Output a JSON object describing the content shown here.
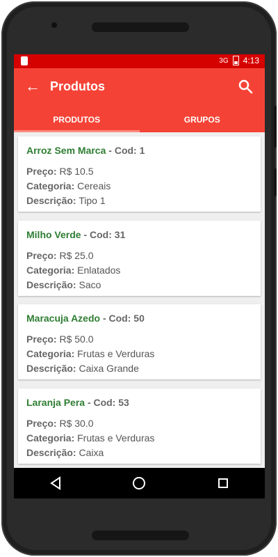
{
  "status_bar": {
    "signal": "3G",
    "time": "4:13"
  },
  "app_bar": {
    "title": "Produtos"
  },
  "tabs": [
    {
      "label": "PRODUTOS",
      "active": true
    },
    {
      "label": "GRUPOS",
      "active": false
    }
  ],
  "products": [
    {
      "name": "Arroz Sem Marca",
      "cod_text": " - Cod: 1",
      "preco_label": "Preço:",
      "preco": "R$ 10.5",
      "categoria_label": "Categoria:",
      "categoria": "Cereais",
      "descricao_label": "Descrição:",
      "descricao": "Tipo 1"
    },
    {
      "name": "Milho Verde",
      "cod_text": " - Cod: 31",
      "preco_label": "Preço:",
      "preco": "R$ 25.0",
      "categoria_label": "Categoria:",
      "categoria": "Enlatados",
      "descricao_label": "Descrição:",
      "descricao": "Saco"
    },
    {
      "name": "Maracuja Azedo",
      "cod_text": " - Cod: 50",
      "preco_label": "Preço:",
      "preco": "R$ 50.0",
      "categoria_label": "Categoria:",
      "categoria": "Frutas e Verduras",
      "descricao_label": "Descrição:",
      "descricao": "Caixa Grande"
    },
    {
      "name": "Laranja Pera",
      "cod_text": " - Cod: 53",
      "preco_label": "Preço:",
      "preco": "R$ 30.0",
      "categoria_label": "Categoria:",
      "categoria": "Frutas e Verduras",
      "descricao_label": "Descrição:",
      "descricao": "Caixa"
    }
  ],
  "colors": {
    "status_bar": "#d50000",
    "app_bar": "#f44336",
    "product_name": "#2e7d32"
  },
  "icons": {
    "back": "arrow-left-icon",
    "search": "search-icon",
    "nav_back": "triangle-back-icon",
    "nav_home": "circle-home-icon",
    "nav_recent": "square-recent-icon"
  }
}
